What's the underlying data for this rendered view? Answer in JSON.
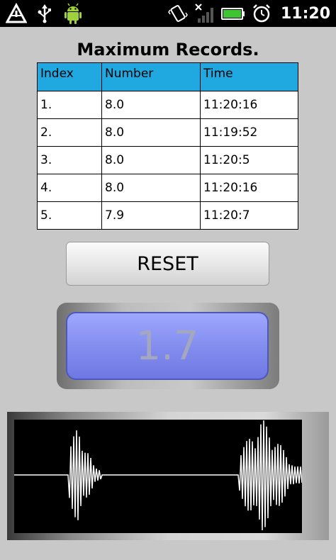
{
  "status_bar": {
    "time": "11:20",
    "left_icons": [
      "warning-icon",
      "usb-icon",
      "android-icon"
    ],
    "right_icons": [
      "vibrate-icon",
      "no-signal-icon",
      "battery-icon",
      "alarm-icon"
    ]
  },
  "title": "Maximum Records.",
  "table": {
    "headers": [
      "Index",
      "Number",
      "Time"
    ],
    "rows": [
      [
        "1.",
        "8.0",
        "11:20:16"
      ],
      [
        "2.",
        "8.0",
        "11:19:52"
      ],
      [
        "3.",
        "8.0",
        "11:20:5"
      ],
      [
        "4.",
        "8.0",
        "11:20:16"
      ],
      [
        "5.",
        "7.9",
        "11:20:7"
      ]
    ]
  },
  "reset_label": "RESET",
  "current_value": "1.7",
  "colors": {
    "table_header": "#1fa9e0",
    "value_box": "#8690f0",
    "value_text": "#a3a7bf",
    "waveform_line": "#ffffff",
    "waveform_bg": "#000000"
  }
}
